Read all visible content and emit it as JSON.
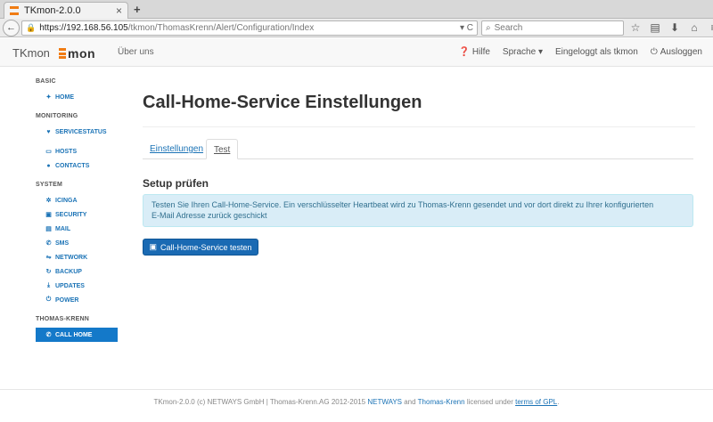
{
  "browser": {
    "tab_title": "TKmon-2.0.0",
    "tab_close": "×",
    "new_tab": "+",
    "back": "←",
    "url_host": "https://192.168.56.105",
    "url_path": "/tkmon/ThomasKrenn/Alert/Configuration/Index",
    "url_right": "▾ C",
    "search_placeholder": "Search"
  },
  "header": {
    "brand": "TKmon",
    "logo_text": "mon",
    "nav_about": "Über uns",
    "help": "Hilfe",
    "language": "Sprache ▾",
    "logged_in": "Eingeloggt als tkmon",
    "logout": "Ausloggen"
  },
  "sidebar": {
    "basic_head": "BASIC",
    "home": "HOME",
    "monitoring_head": "MONITORING",
    "servicestatus": "SERVICESTATUS",
    "hosts": "HOSTS",
    "contacts": "CONTACTS",
    "system_head": "SYSTEM",
    "icinga": "ICINGA",
    "security": "SECURITY",
    "mail": "MAIL",
    "sms": "SMS",
    "network": "NETWORK",
    "backup": "BACKUP",
    "updates": "UPDATES",
    "power": "POWER",
    "tk_head": "THOMAS-KRENN",
    "callhome": "CALL HOME"
  },
  "main": {
    "title": "Call-Home-Service Einstellungen",
    "tab_settings": "Einstellungen",
    "tab_test": "Test",
    "setup_title": "Setup prüfen",
    "alert_line1": "Testen Sie Ihren Call-Home-Service. Ein verschlüsselter Heartbeat wird zu Thomas-Krenn gesendet und vor dort direkt zu Ihrer konfigurierten",
    "alert_line2": "E-Mail Adresse zurück geschickt",
    "test_button": "Call-Home-Service testen"
  },
  "footer": {
    "prefix": "TKmon-2.0.0 (c) NETWAYS GmbH | Thomas-Krenn.AG 2012-2015",
    "netways": "NETWAYS",
    "and": "and",
    "thomas_krenn": "Thomas-Krenn",
    "licensed": "licensed under",
    "gpl": "terms of GPL",
    "dot": "."
  },
  "colors": {
    "accent": "#1479c9",
    "brand_orange": "#f07c13",
    "alert_bg": "#d9edf7"
  }
}
